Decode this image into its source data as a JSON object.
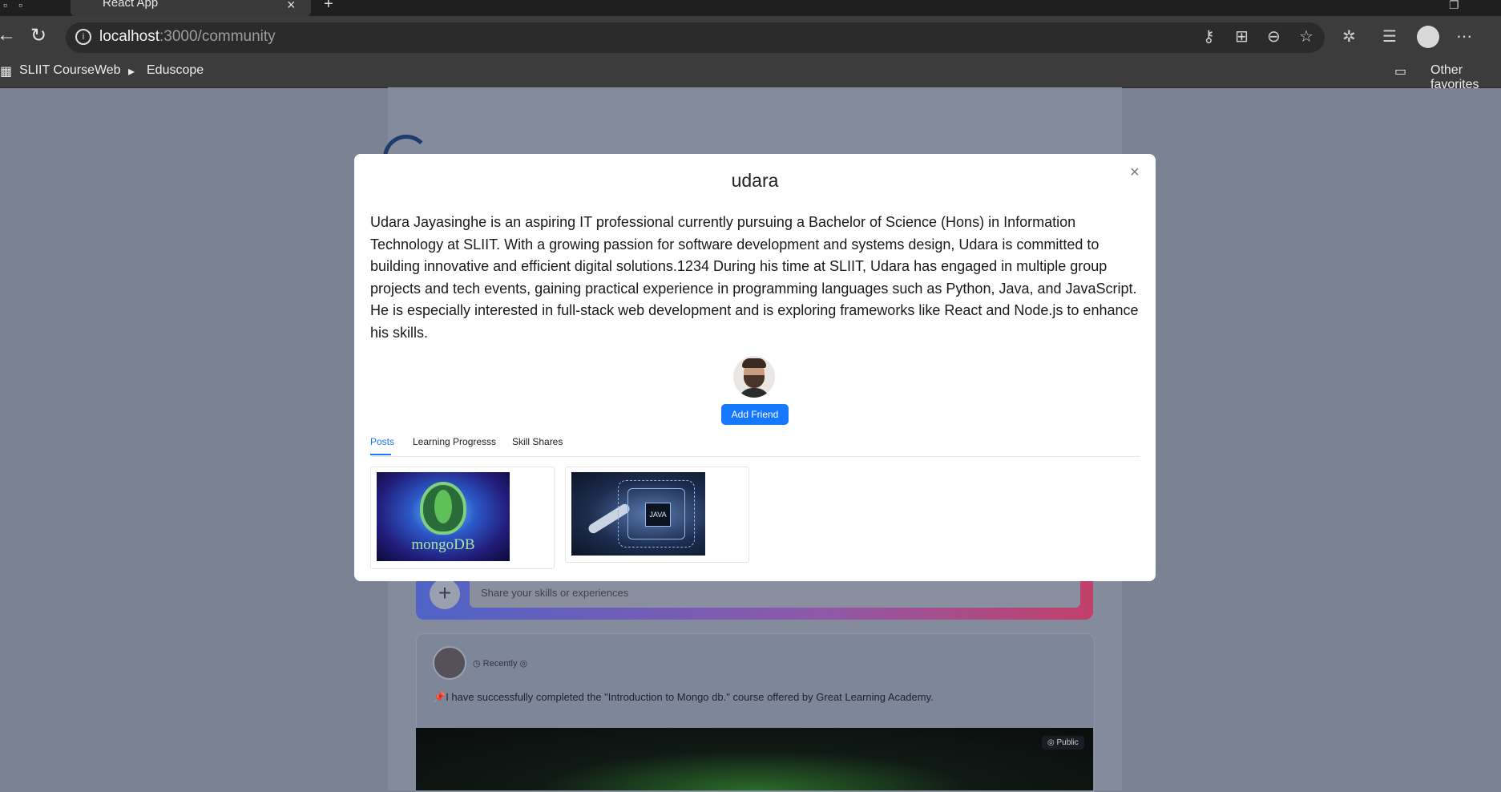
{
  "browser": {
    "tab_title": "React App",
    "tab_close": "×",
    "new_tab": "+",
    "url_host": "localhost",
    "url_path": ":3000/community",
    "bookmarks": [
      "SLIIT CourseWeb",
      "Eduscope"
    ],
    "other_favorites": "Other favorites"
  },
  "page": {
    "share_placeholder": "Share your skills or experiences",
    "post_time": "Recently",
    "post_text": "I have successfully completed the \"Introduction to Mongo db.\" course offered by Great Learning Academy.",
    "post_visibility": "Public"
  },
  "modal": {
    "title": "udara",
    "close": "×",
    "bio": "Udara Jayasinghe is an aspiring IT professional currently pursuing a Bachelor of Science (Hons) in Information Technology at SLIIT. With a growing passion for software development and systems design, Udara is committed to building innovative and efficient digital solutions.1234 During his time at SLIIT, Udara has engaged in multiple group projects and tech events, gaining practical experience in programming languages such as Python, Java, and JavaScript. He is especially interested in full-stack web development and is exploring frameworks like React and Node.js to enhance his skills.",
    "add_friend": "Add Friend",
    "tabs": [
      {
        "label": "Posts",
        "active": true
      },
      {
        "label": "Learning Progresss",
        "active": false
      },
      {
        "label": "Skill Shares",
        "active": false
      }
    ],
    "thumbnails": [
      {
        "caption": "mongoDB"
      },
      {
        "caption": "JAVA"
      }
    ]
  },
  "colors": {
    "accent": "#1677ff",
    "overlay": "#7b8294"
  }
}
